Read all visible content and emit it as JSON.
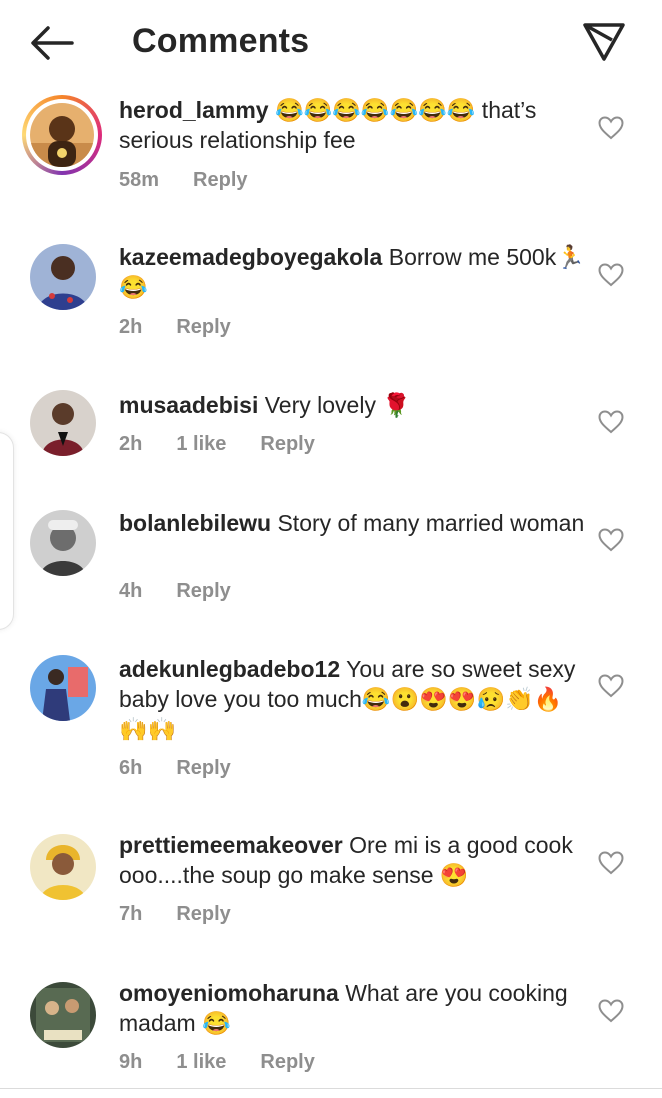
{
  "header": {
    "title": "Comments"
  },
  "comments": [
    {
      "username": "herod_lammy",
      "text": "😂😂😂😂😂😂😂 that’s serious relationship fee",
      "time": "58m",
      "likes": "",
      "reply": "Reply"
    },
    {
      "username": "kazeemadegboyegakola",
      "text": "Borrow me 500k🏃😂",
      "time": "2h",
      "likes": "",
      "reply": "Reply"
    },
    {
      "username": "musaadebisi",
      "text": "Very lovely 🌹",
      "time": "2h",
      "likes": "1 like",
      "reply": "Reply"
    },
    {
      "username": "bolanlebilewu",
      "text": "Story of many married woman",
      "time": "4h",
      "likes": "",
      "reply": "Reply"
    },
    {
      "username": "adekunlegbadebo12",
      "text": "You are so sweet sexy baby love you too much😂😮😍😍😥👏🔥🙌🙌",
      "time": "6h",
      "likes": "",
      "reply": "Reply"
    },
    {
      "username": "prettiemeemakeover",
      "text": "Ore mi is a good cook ooo....the soup go make sense 😍",
      "time": "7h",
      "likes": "",
      "reply": "Reply"
    },
    {
      "username": "omoyeniomoharuna",
      "text": "What are you cooking madam 😂",
      "time": "9h",
      "likes": "1 like",
      "reply": "Reply"
    }
  ]
}
